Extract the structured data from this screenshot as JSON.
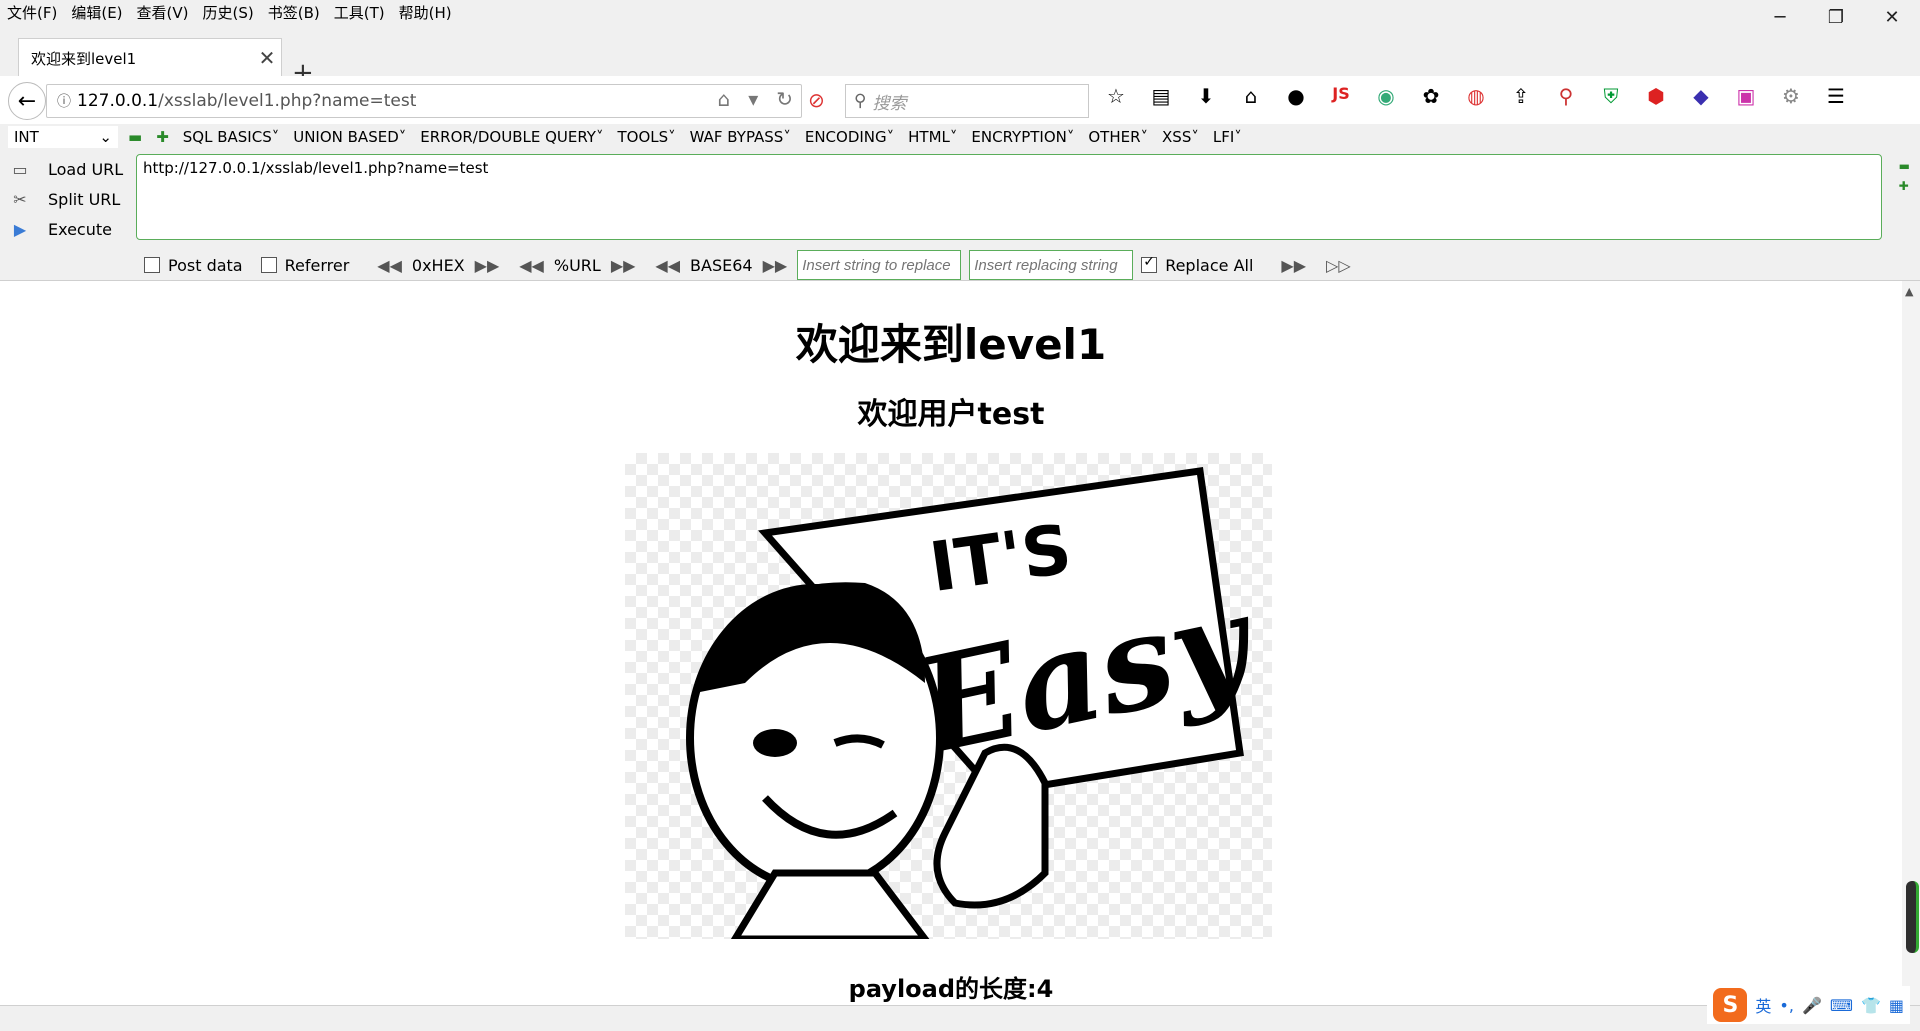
{
  "menubar": {
    "items": [
      "文件(F)",
      "编辑(E)",
      "查看(V)",
      "历史(S)",
      "书签(B)",
      "工具(T)",
      "帮助(H)"
    ]
  },
  "window_controls": {
    "minimize": "─",
    "restore": "❐",
    "close": "✕"
  },
  "tab": {
    "title": "欢迎来到level1",
    "close": "✕"
  },
  "newtab": "+",
  "nav": {
    "back": "←",
    "info": "ⓘ",
    "url_host": "127.0.0.1",
    "url_path": "/xsslab/level1.php?name=test",
    "search_placeholder": "搜索",
    "search_icon": "⚲"
  },
  "toolbar_icons": [
    "star-icon",
    "reading-list-icon",
    "download-icon",
    "home-icon",
    "extension-icon",
    "js-icon",
    "color-icon",
    "palette-icon",
    "red-shield-icon",
    "share-icon",
    "zoom-icon",
    "ublock-icon",
    "abp-icon",
    "layers-icon",
    "tag-icon",
    "settings-icon",
    "menu-icon"
  ],
  "hackbar": {
    "select": "INT",
    "menus": [
      "SQL BASICS",
      "UNION BASED",
      "ERROR/DOUBLE QUERY",
      "TOOLS",
      "WAF BYPASS",
      "ENCODING",
      "HTML",
      "ENCRYPTION",
      "OTHER",
      "XSS",
      "LFI"
    ],
    "load_url": "Load URL",
    "split_url": "Split URL",
    "execute": "Execute",
    "url_text": "http://127.0.0.1/xsslab/level1.php?name=test",
    "post_data": "Post data",
    "referrer": "Referrer",
    "hex": "0xHEX",
    "url_enc": "%URL",
    "base64": "BASE64",
    "find_placeholder": "Insert string to replace",
    "replace_placeholder": "Insert replacing string",
    "replace_all": "Replace All"
  },
  "page": {
    "heading": "欢迎来到level1",
    "subheading": "欢迎用户test",
    "image_text_1": "IT'S",
    "image_text_2": "Easy",
    "payload_len": "payload的长度:4"
  },
  "ime": {
    "logo": "S",
    "lang": "英"
  }
}
